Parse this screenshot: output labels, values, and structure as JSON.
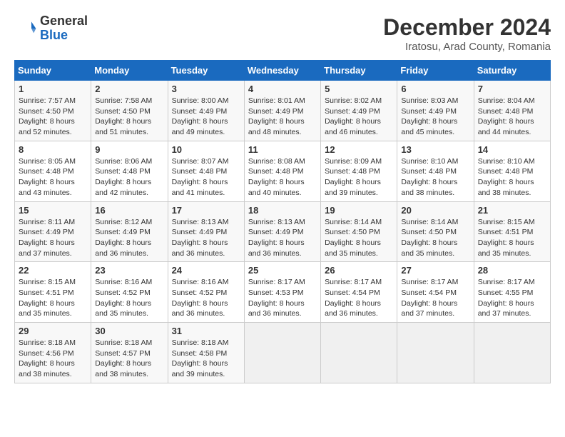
{
  "header": {
    "logo_general": "General",
    "logo_blue": "Blue",
    "title": "December 2024",
    "location": "Iratosu, Arad County, Romania"
  },
  "days_of_week": [
    "Sunday",
    "Monday",
    "Tuesday",
    "Wednesday",
    "Thursday",
    "Friday",
    "Saturday"
  ],
  "weeks": [
    [
      {
        "day": "1",
        "sunrise": "7:57 AM",
        "sunset": "4:50 PM",
        "daylight": "8 hours and 52 minutes."
      },
      {
        "day": "2",
        "sunrise": "7:58 AM",
        "sunset": "4:50 PM",
        "daylight": "8 hours and 51 minutes."
      },
      {
        "day": "3",
        "sunrise": "8:00 AM",
        "sunset": "4:49 PM",
        "daylight": "8 hours and 49 minutes."
      },
      {
        "day": "4",
        "sunrise": "8:01 AM",
        "sunset": "4:49 PM",
        "daylight": "8 hours and 48 minutes."
      },
      {
        "day": "5",
        "sunrise": "8:02 AM",
        "sunset": "4:49 PM",
        "daylight": "8 hours and 46 minutes."
      },
      {
        "day": "6",
        "sunrise": "8:03 AM",
        "sunset": "4:49 PM",
        "daylight": "8 hours and 45 minutes."
      },
      {
        "day": "7",
        "sunrise": "8:04 AM",
        "sunset": "4:48 PM",
        "daylight": "8 hours and 44 minutes."
      }
    ],
    [
      {
        "day": "8",
        "sunrise": "8:05 AM",
        "sunset": "4:48 PM",
        "daylight": "8 hours and 43 minutes."
      },
      {
        "day": "9",
        "sunrise": "8:06 AM",
        "sunset": "4:48 PM",
        "daylight": "8 hours and 42 minutes."
      },
      {
        "day": "10",
        "sunrise": "8:07 AM",
        "sunset": "4:48 PM",
        "daylight": "8 hours and 41 minutes."
      },
      {
        "day": "11",
        "sunrise": "8:08 AM",
        "sunset": "4:48 PM",
        "daylight": "8 hours and 40 minutes."
      },
      {
        "day": "12",
        "sunrise": "8:09 AM",
        "sunset": "4:48 PM",
        "daylight": "8 hours and 39 minutes."
      },
      {
        "day": "13",
        "sunrise": "8:10 AM",
        "sunset": "4:48 PM",
        "daylight": "8 hours and 38 minutes."
      },
      {
        "day": "14",
        "sunrise": "8:10 AM",
        "sunset": "4:48 PM",
        "daylight": "8 hours and 38 minutes."
      }
    ],
    [
      {
        "day": "15",
        "sunrise": "8:11 AM",
        "sunset": "4:49 PM",
        "daylight": "8 hours and 37 minutes."
      },
      {
        "day": "16",
        "sunrise": "8:12 AM",
        "sunset": "4:49 PM",
        "daylight": "8 hours and 36 minutes."
      },
      {
        "day": "17",
        "sunrise": "8:13 AM",
        "sunset": "4:49 PM",
        "daylight": "8 hours and 36 minutes."
      },
      {
        "day": "18",
        "sunrise": "8:13 AM",
        "sunset": "4:49 PM",
        "daylight": "8 hours and 36 minutes."
      },
      {
        "day": "19",
        "sunrise": "8:14 AM",
        "sunset": "4:50 PM",
        "daylight": "8 hours and 35 minutes."
      },
      {
        "day": "20",
        "sunrise": "8:14 AM",
        "sunset": "4:50 PM",
        "daylight": "8 hours and 35 minutes."
      },
      {
        "day": "21",
        "sunrise": "8:15 AM",
        "sunset": "4:51 PM",
        "daylight": "8 hours and 35 minutes."
      }
    ],
    [
      {
        "day": "22",
        "sunrise": "8:15 AM",
        "sunset": "4:51 PM",
        "daylight": "8 hours and 35 minutes."
      },
      {
        "day": "23",
        "sunrise": "8:16 AM",
        "sunset": "4:52 PM",
        "daylight": "8 hours and 35 minutes."
      },
      {
        "day": "24",
        "sunrise": "8:16 AM",
        "sunset": "4:52 PM",
        "daylight": "8 hours and 36 minutes."
      },
      {
        "day": "25",
        "sunrise": "8:17 AM",
        "sunset": "4:53 PM",
        "daylight": "8 hours and 36 minutes."
      },
      {
        "day": "26",
        "sunrise": "8:17 AM",
        "sunset": "4:54 PM",
        "daylight": "8 hours and 36 minutes."
      },
      {
        "day": "27",
        "sunrise": "8:17 AM",
        "sunset": "4:54 PM",
        "daylight": "8 hours and 37 minutes."
      },
      {
        "day": "28",
        "sunrise": "8:17 AM",
        "sunset": "4:55 PM",
        "daylight": "8 hours and 37 minutes."
      }
    ],
    [
      {
        "day": "29",
        "sunrise": "8:18 AM",
        "sunset": "4:56 PM",
        "daylight": "8 hours and 38 minutes."
      },
      {
        "day": "30",
        "sunrise": "8:18 AM",
        "sunset": "4:57 PM",
        "daylight": "8 hours and 38 minutes."
      },
      {
        "day": "31",
        "sunrise": "8:18 AM",
        "sunset": "4:58 PM",
        "daylight": "8 hours and 39 minutes."
      },
      null,
      null,
      null,
      null
    ]
  ]
}
